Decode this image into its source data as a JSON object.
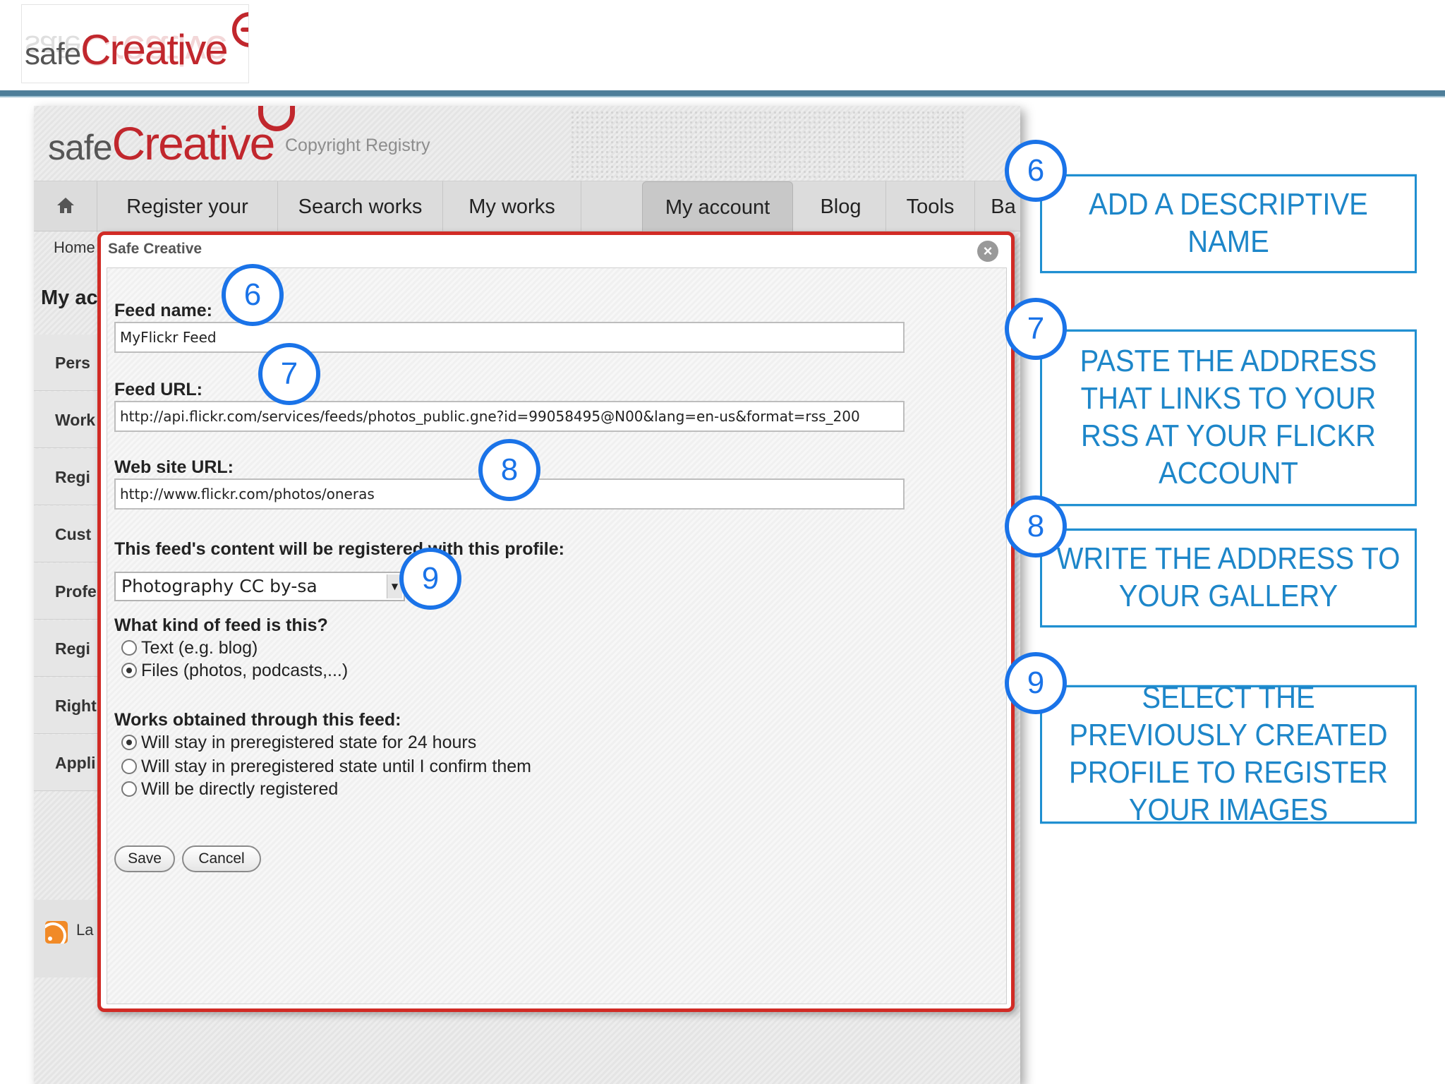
{
  "slide": {
    "logo": {
      "safe": "safe",
      "creative": "Creative"
    },
    "accent_color": "#c1272d",
    "rule_color": "#4e7e99"
  },
  "site": {
    "logo": {
      "safe": "safe",
      "creative": "Creative"
    },
    "tagline": "Copyright Registry",
    "nav": {
      "home_icon": "home-icon",
      "items": [
        "Register your works",
        "Search works",
        "My works",
        "My account",
        "Blog",
        "Tools",
        "Ba"
      ],
      "active": "My account"
    },
    "breadcrumb": "Home",
    "left_title": "My ac",
    "left_items": [
      "Pers",
      "Work",
      "Regi",
      "Cust",
      "Profe",
      "Regi",
      "Right",
      "Appli"
    ],
    "rss_text": "La"
  },
  "modal": {
    "title": "Safe Creative",
    "close_icon": "close-icon",
    "feed_name": {
      "label": "Feed name:",
      "value": "MyFlickr Feed"
    },
    "feed_url": {
      "label": "Feed URL:",
      "value": "http://api.flickr.com/services/feeds/photos_public.gne?id=99058495@N00&lang=en-us&format=rss_200"
    },
    "website_url": {
      "label": "Web site URL:",
      "value": "http://www.flickr.com/photos/oneras"
    },
    "profile": {
      "label": "This feed's content will be registered with this profile:",
      "value": "Photography CC by-sa"
    },
    "feed_kind": {
      "label": "What kind of feed is this?",
      "options": [
        {
          "label": "Text (e.g. blog)",
          "selected": false
        },
        {
          "label": "Files (photos, podcasts,...)",
          "selected": true
        }
      ]
    },
    "works": {
      "label": "Works obtained through this feed:",
      "options": [
        {
          "label": "Will stay in preregistered state for 24 hours",
          "selected": true
        },
        {
          "label": "Will stay in preregistered state until I confirm them",
          "selected": false
        },
        {
          "label": "Will be directly registered",
          "selected": false
        }
      ]
    },
    "save_label": "Save",
    "cancel_label": "Cancel",
    "border_color": "#d12b25"
  },
  "markers": [
    "6",
    "7",
    "8",
    "9"
  ],
  "marker_color": "#1a73e8",
  "callouts": [
    {
      "number": "6",
      "text": "ADD A DESCRIPTIVE NAME"
    },
    {
      "number": "7",
      "text": "PASTE THE ADDRESS THAT LINKS TO YOUR RSS AT YOUR FLICKR ACCOUNT"
    },
    {
      "number": "8",
      "text": "WRITE THE ADDRESS TO YOUR GALLERY"
    },
    {
      "number": "9",
      "text": "SELECT THE PREVIOUSLY CREATED PROFILE TO REGISTER YOUR IMAGES"
    }
  ],
  "callout_color": "#1d86c9"
}
